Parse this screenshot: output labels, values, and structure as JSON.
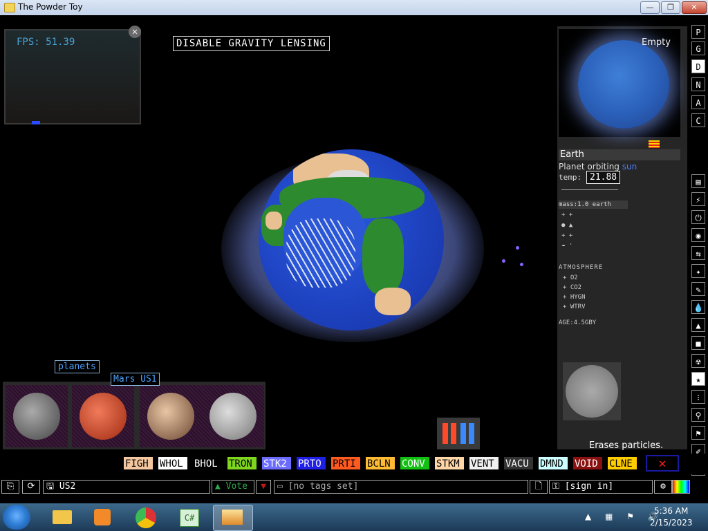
{
  "window": {
    "title": "The Powder Toy",
    "min_label": "—",
    "max_label": "❐",
    "close_label": "✕"
  },
  "sim": {
    "fps": "FPS: 51.39",
    "fps_close": "✕",
    "lensing_button": "DISABLE GRAVITY LENSING"
  },
  "info": {
    "mini_label": "Empty",
    "name": "Earth",
    "orbiting_prefix": "Planet orbiting",
    "orbiting_target": "sun",
    "temp_label": "temp:",
    "temp_value": "21.88",
    "mass_label": "mass:1.0 earth",
    "atmosphere_label": "ATMOSPHERE",
    "atmosphere": [
      "O2",
      "CO2",
      "HYGN",
      "WTRV"
    ],
    "age_label": "AGE:4.5GBY",
    "status": "Erases particles."
  },
  "right_toolbar": [
    "P",
    "G",
    "D",
    "N",
    "A",
    "C"
  ],
  "planets": {
    "category_label": "planets",
    "hover_label": "Mars US1"
  },
  "elements": [
    {
      "label": "FIGH",
      "bg": "#f5c7a0",
      "fg": "#000000"
    },
    {
      "label": "WHOL",
      "bg": "#ffffff",
      "fg": "#000000"
    },
    {
      "label": "BHOL",
      "bg": "#000000",
      "fg": "#ffffff"
    },
    {
      "label": "TRON",
      "bg": "#7fd61f",
      "fg": "#000000"
    },
    {
      "label": "STK2",
      "bg": "#6b6bff",
      "fg": "#ffffff"
    },
    {
      "label": "PRTO",
      "bg": "#1f1fe6",
      "fg": "#ffffff"
    },
    {
      "label": "PRTI",
      "bg": "#ff5a1f",
      "fg": "#000000"
    },
    {
      "label": "BCLN",
      "bg": "#ffbb33",
      "fg": "#000000"
    },
    {
      "label": "CONV",
      "bg": "#11c011",
      "fg": "#ffffff"
    },
    {
      "label": "STKM",
      "bg": "#ffd6a6",
      "fg": "#000000"
    },
    {
      "label": "VENT",
      "bg": "#f0f0f0",
      "fg": "#000000"
    },
    {
      "label": "VACU",
      "bg": "#333333",
      "fg": "#ffffff"
    },
    {
      "label": "DMND",
      "bg": "#ccffff",
      "fg": "#000000"
    },
    {
      "label": "VOID",
      "bg": "#8a1111",
      "fg": "#ffffff"
    },
    {
      "label": "CLNE",
      "bg": "#ffcc00",
      "fg": "#000000"
    }
  ],
  "erase_selected": "✕",
  "bottom": {
    "save_name": "US2",
    "vote_label": "Vote",
    "tags": "[no tags set]",
    "sign_in": "[sign in]"
  },
  "taskbar": {
    "time": "5:36 AM",
    "date": "2/15/2023"
  }
}
